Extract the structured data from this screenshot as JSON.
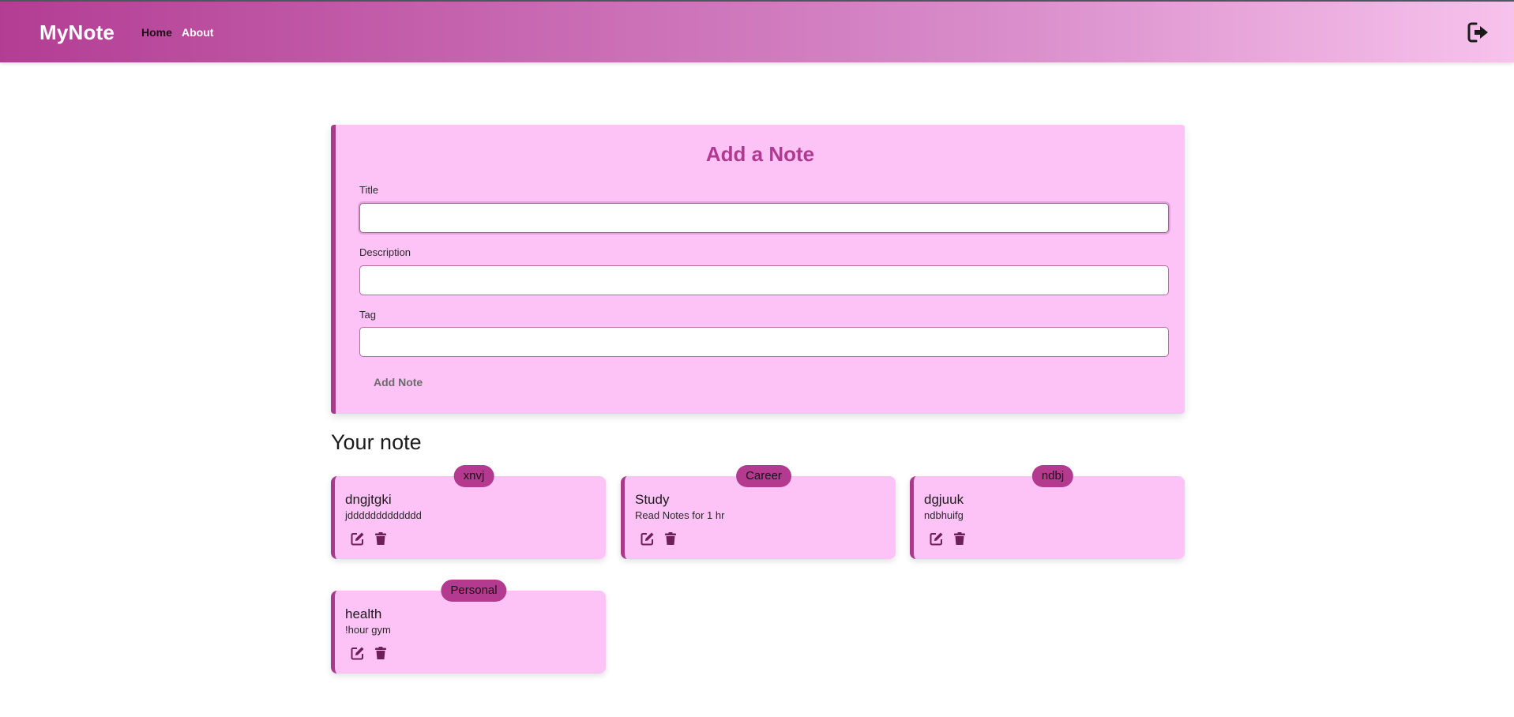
{
  "navbar": {
    "brand": "MyNote",
    "links": [
      {
        "label": "Home"
      },
      {
        "label": "About"
      }
    ],
    "logout_icon": "sign-out-icon"
  },
  "add_note": {
    "heading": "Add a Note",
    "title_label": "Title",
    "title_value": "",
    "description_label": "Description",
    "description_value": "",
    "tag_label": "Tag",
    "tag_value": "",
    "submit_label": "Add Note"
  },
  "notes_section": {
    "heading": "Your note",
    "notes": [
      {
        "tag": "xnvj",
        "title": "dngjtgki",
        "description": "jddddddddddddd"
      },
      {
        "tag": "Career",
        "title": "Study",
        "description": "Read Notes for 1 hr"
      },
      {
        "tag": "ndbj",
        "title": "dgjuuk",
        "description": "ndbhuifg"
      },
      {
        "tag": "Personal",
        "title": "health",
        "description": "!hour gym"
      }
    ],
    "edit_icon": "edit-icon",
    "delete_icon": "trash-icon"
  },
  "colors": {
    "accent": "#b33a8f",
    "card_background": "#fdc2f6",
    "navbar_gradient_start": "#b33d93",
    "navbar_gradient_end": "#f7c2ec"
  }
}
